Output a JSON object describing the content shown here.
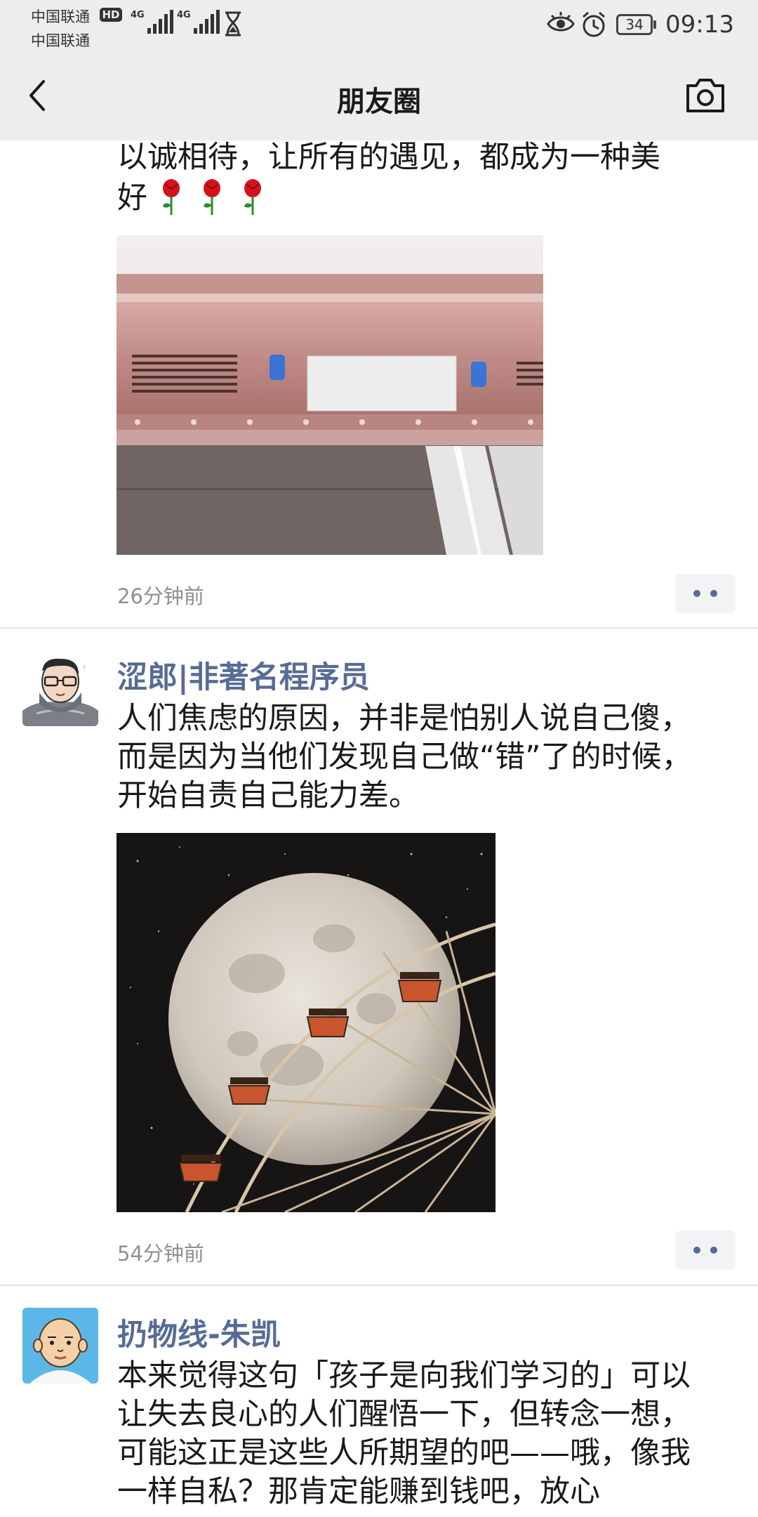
{
  "status_bar": {
    "carrier_1": "中国联通",
    "carrier_2": "中国联通",
    "hd_badge": "HD",
    "network_1": "4G",
    "network_2": "4G",
    "battery_level": "34",
    "time": "09:13"
  },
  "nav": {
    "title": "朋友圈",
    "back_icon": "chevron-left-icon",
    "camera_icon": "camera-icon"
  },
  "posts": [
    {
      "text_line_1": "以诚相待，让所有的遇见，都成为一种美",
      "text_line_2": "好",
      "emoji": "rose",
      "image": "pink-ceiling-air-heater-photo",
      "time": "26分钟前"
    },
    {
      "author": "涩郎|非著名程序员",
      "text": "人们焦虑的原因，并非是怕别人说自己傻，而是因为当他们发现自己做“错”了的时候，开始自责自己能力差。",
      "image": "moon-ferris-wheel-photo",
      "time": "54分钟前"
    },
    {
      "author": "扔物线-朱凯",
      "text": "本来觉得这句「孩子是向我们学习的」可以让失去良心的人们醒悟一下，但转念一想，可能这正是这些人所期望的吧——哦，像我一样自私？那肯定能赚到钱吧，放心"
    }
  ],
  "colors": {
    "author_link": "#576b95",
    "header_bg": "#ededed",
    "timestamp": "#8f8f8f"
  }
}
